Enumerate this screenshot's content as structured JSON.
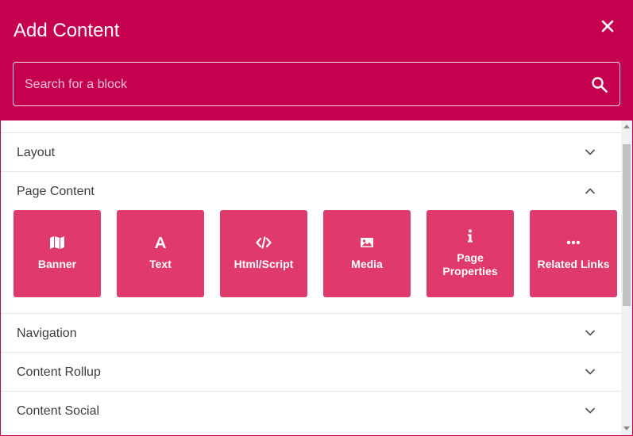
{
  "dialog": {
    "title": "Add Content",
    "close_icon": "close-icon",
    "accent_color": "#c4004f",
    "tile_color": "#e0396b"
  },
  "search": {
    "placeholder": "Search for a block",
    "value": "",
    "icon": "search-icon"
  },
  "sections": [
    {
      "label": "Layout",
      "expanded": false
    },
    {
      "label": "Page Content",
      "expanded": true
    },
    {
      "label": "Navigation",
      "expanded": false
    },
    {
      "label": "Content Rollup",
      "expanded": false
    },
    {
      "label": "Content Social",
      "expanded": false
    }
  ],
  "blocks": [
    {
      "label": "Banner",
      "icon": "map-icon"
    },
    {
      "label": "Text",
      "icon": "font-icon"
    },
    {
      "label": "Html/Script",
      "icon": "code-icon"
    },
    {
      "label": "Media",
      "icon": "image-icon"
    },
    {
      "label": "Page Properties",
      "icon": "info-icon"
    },
    {
      "label": "Related Links",
      "icon": "ellipsis-icon"
    }
  ]
}
